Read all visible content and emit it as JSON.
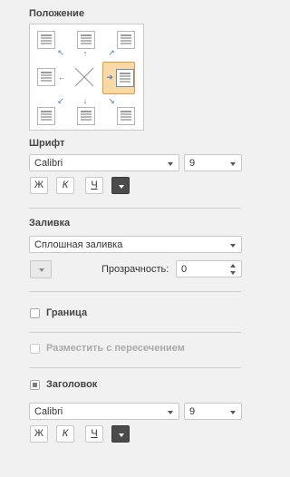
{
  "position": {
    "title": "Положение"
  },
  "font": {
    "title": "Шрифт",
    "family": "Calibri",
    "size": "9",
    "bold": "Ж",
    "italic": "К",
    "underline": "Ч"
  },
  "fill": {
    "title": "Заливка",
    "type": "Сплошная заливка",
    "transparency_label": "Прозрачность:",
    "transparency_value": "0"
  },
  "border": {
    "label": "Граница"
  },
  "overlay": {
    "label": "Разместить с пересечением"
  },
  "heading": {
    "label": "Заголовок",
    "family": "Calibri",
    "size": "9",
    "bold": "Ж",
    "italic": "К",
    "underline": "Ч"
  },
  "colors": {
    "selected_bg": "#f9d9a8",
    "selected_border": "#e39a37",
    "arrow": "#4f7fb4",
    "color_button": "#4b4b4b"
  }
}
